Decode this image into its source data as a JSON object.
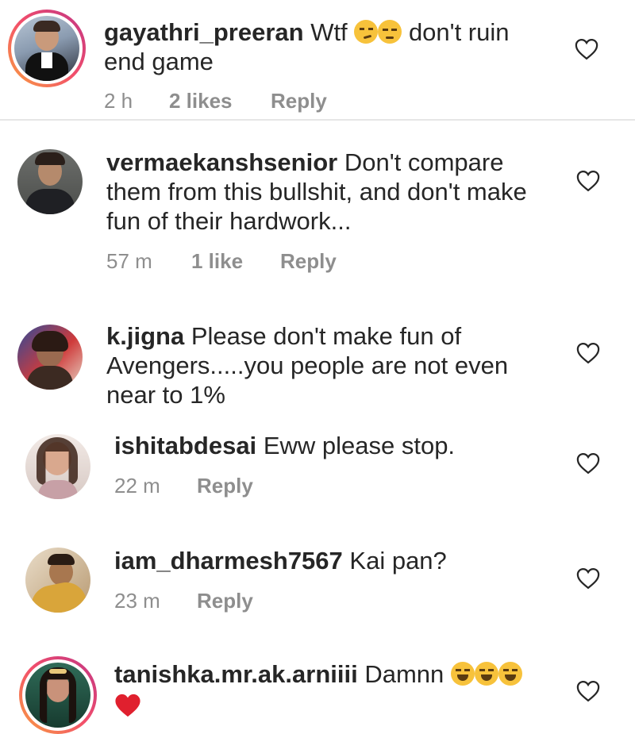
{
  "comments": [
    {
      "username": "gayathri_preeran",
      "text_1": "Wtf",
      "text_2": "don't ruin",
      "text_3": "end game",
      "emojis": [
        "smirking-face-emoji",
        "unamused-face-emoji"
      ],
      "time": "2 h",
      "likes": "2 likes",
      "reply": "Reply"
    },
    {
      "username": "vermaekanshsenior",
      "text_1": "Don't compare",
      "text_2": "them from this bullshit, and don't make",
      "text_3": "fun of their hardwork...",
      "time": "57 m",
      "likes": "1 like",
      "reply": "Reply"
    },
    {
      "username": "k.jigna",
      "text_1": "Please don't make fun of",
      "text_2": "Avengers.....you people are not even",
      "text_3": "near to 1%"
    },
    {
      "username": "ishitabdesai",
      "text_1": "Eww please stop.",
      "time": "22 m",
      "reply": "Reply"
    },
    {
      "username": "iam_dharmesh7567",
      "text_1": "Kai pan?",
      "time": "23 m",
      "reply": "Reply"
    },
    {
      "username": "tanishka.mr.ak.arniiii",
      "text_1": "Damnn",
      "emojis": [
        "face-with-tears-of-joy-emoji",
        "face-with-tears-of-joy-emoji",
        "face-with-tears-of-joy-emoji",
        "red-heart-emoji"
      ]
    }
  ],
  "colors": {
    "text": "#262626",
    "meta": "#8e8e8e",
    "divider": "#e6e6e6",
    "story_ring_start": "#f9a03f",
    "story_ring_end": "#c13584",
    "heart_emoji": "#e0202e"
  },
  "icons": {
    "like": "heart-outline-icon"
  }
}
